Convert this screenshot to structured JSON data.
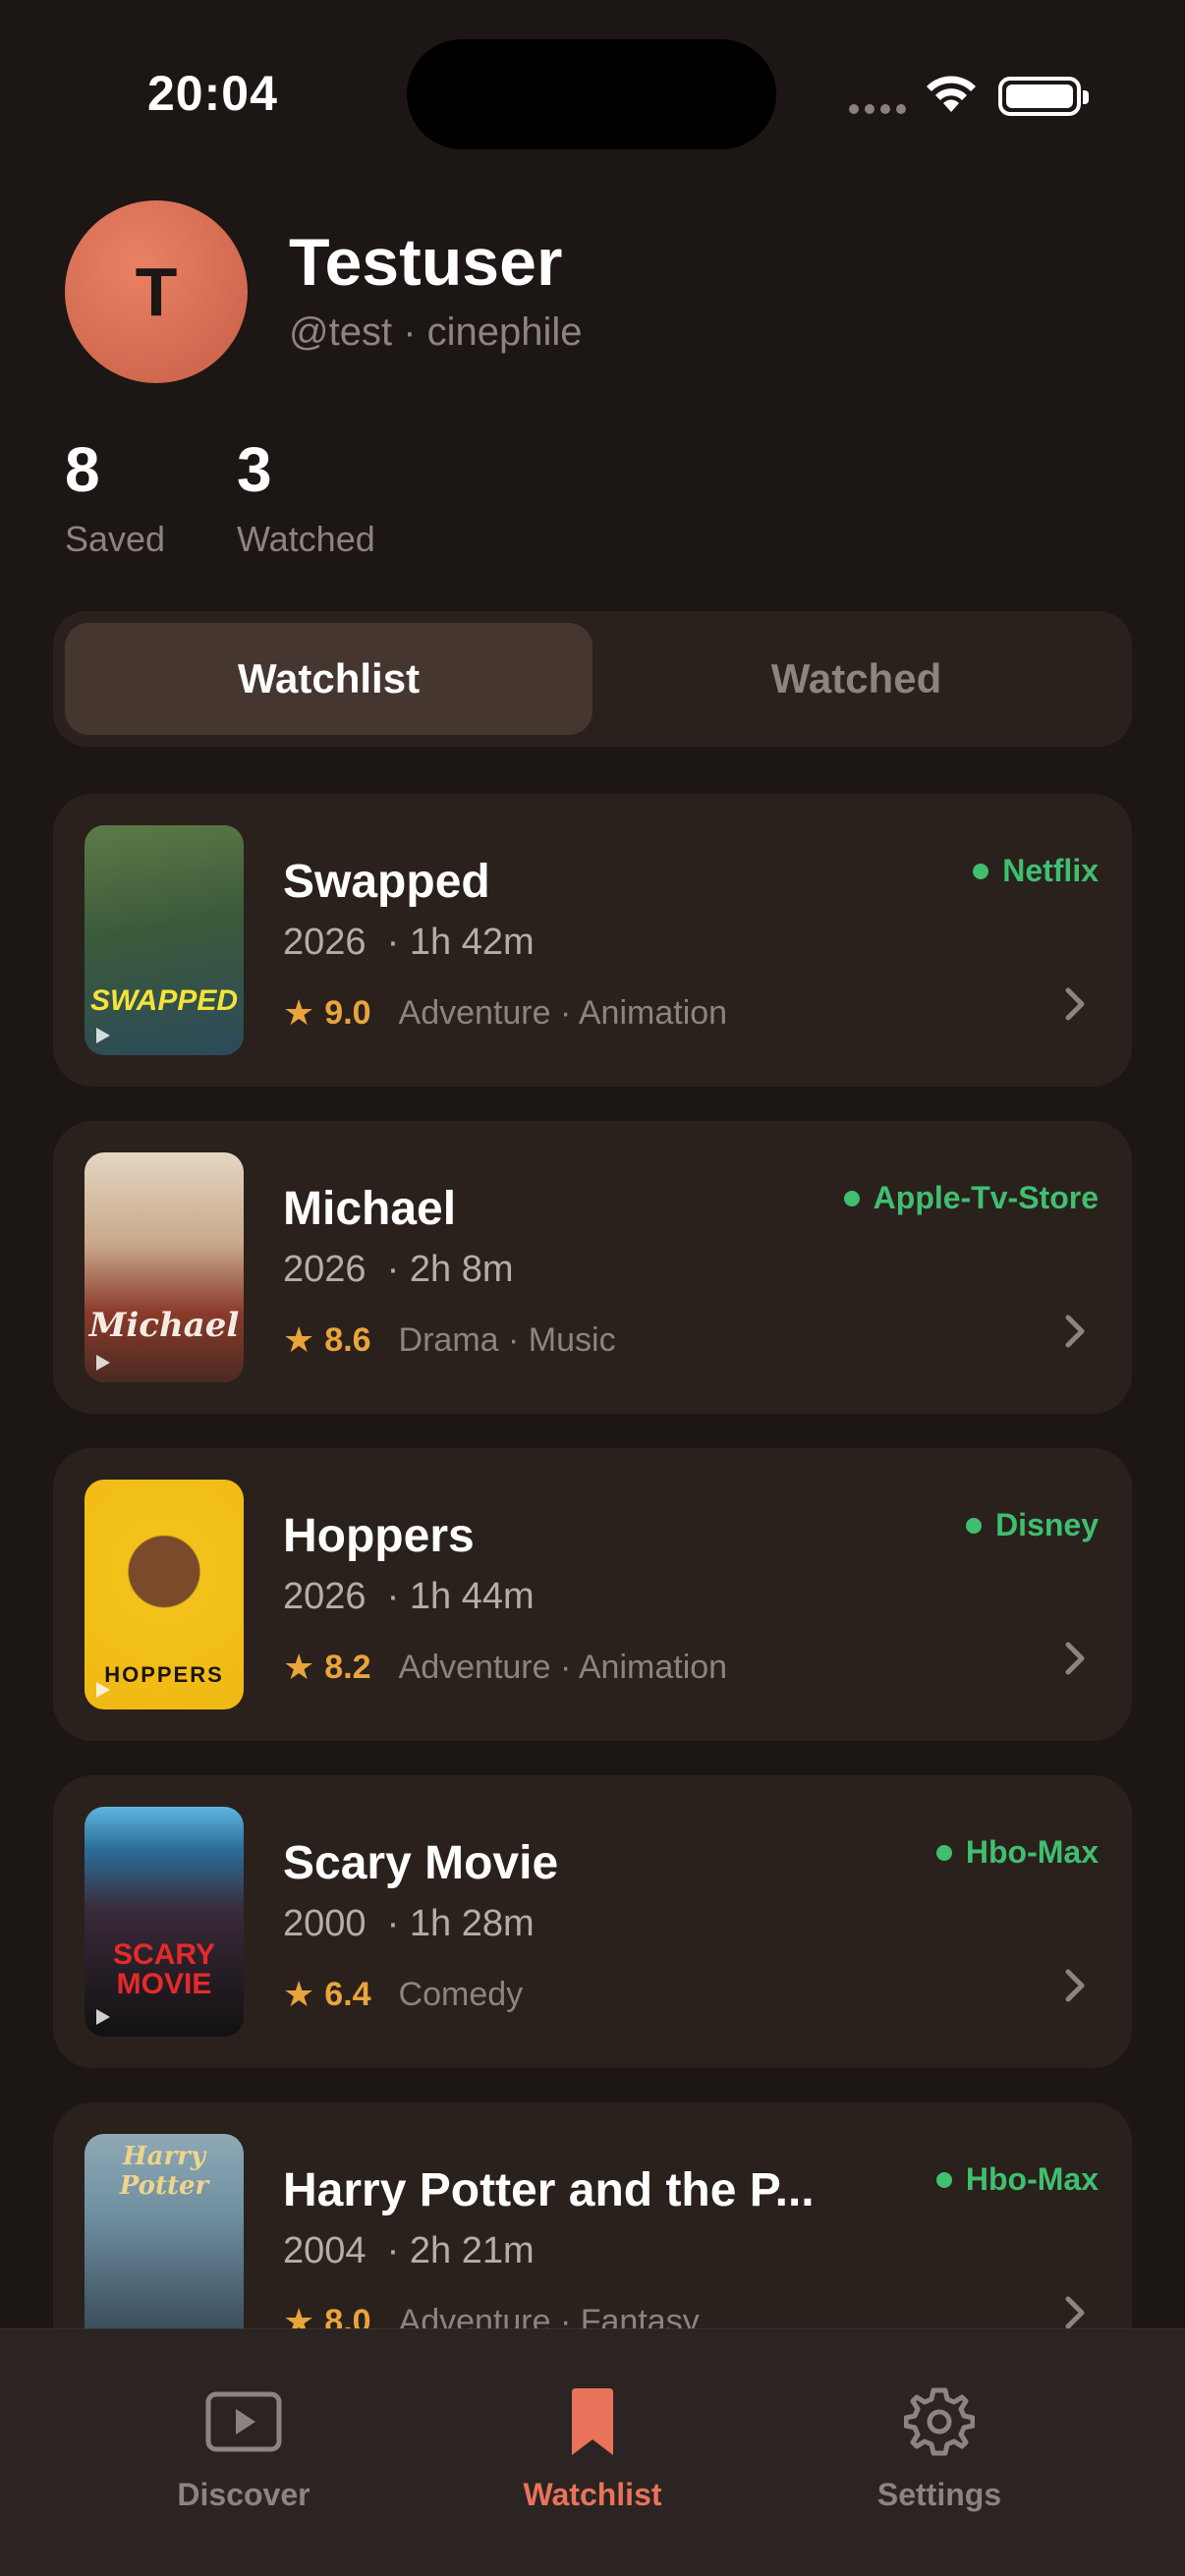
{
  "status_bar": {
    "time": "20:04"
  },
  "profile": {
    "avatar_initial": "T",
    "name": "Testuser",
    "handle": "@test · cinephile"
  },
  "stats": [
    {
      "value": "8",
      "label": "Saved"
    },
    {
      "value": "3",
      "label": "Watched"
    }
  ],
  "segmented": {
    "watchlist_label": "Watchlist",
    "watched_label": "Watched",
    "selected": "Watchlist"
  },
  "movies": [
    {
      "title": "Swapped",
      "year": "2026",
      "runtime": "· 1h 42m",
      "rating": "9.0",
      "genres": "Adventure · Animation",
      "provider": "Netflix",
      "poster_text": "SWAPPED",
      "poster_colors": [
        "#3b5a3a",
        "#2c4a5a"
      ]
    },
    {
      "title": "Michael",
      "year": "2026",
      "runtime": "· 2h 8m",
      "rating": "8.6",
      "genres": "Drama · Music",
      "provider": "Apple-Tv-Store",
      "poster_text": "Michael",
      "poster_colors": [
        "#d9c7b0",
        "#8a3a2a"
      ]
    },
    {
      "title": "Hoppers",
      "year": "2026",
      "runtime": "· 1h 44m",
      "rating": "8.2",
      "genres": "Adventure · Animation",
      "provider": "Disney",
      "poster_text": "HOPPERS",
      "poster_colors": [
        "#f3c21a",
        "#e0a510"
      ]
    },
    {
      "title": "Scary Movie",
      "year": "2000",
      "runtime": "· 1h 28m",
      "rating": "6.4",
      "genres": "Comedy",
      "provider": "Hbo-Max",
      "poster_text": "SCARY MOVIE",
      "poster_colors": [
        "#2a6f9a",
        "#111111"
      ]
    },
    {
      "title": "Harry Potter and the P...",
      "year": "2004",
      "runtime": "· 2h 21m",
      "rating": "8.0",
      "genres": "Adventure · Fantasy",
      "provider": "Hbo-Max",
      "poster_text": "Harry Potter",
      "poster_colors": [
        "#6e8fa0",
        "#2b3a46"
      ]
    }
  ],
  "tabbar": {
    "items": [
      {
        "label": "Discover",
        "icon": "play-rectangle-icon"
      },
      {
        "label": "Watchlist",
        "icon": "bookmark-icon"
      },
      {
        "label": "Settings",
        "icon": "gear-icon"
      }
    ],
    "active": "Watchlist"
  },
  "colors": {
    "accent": "#e8735a",
    "provider_green": "#3fbf6f",
    "rating_gold": "#e8a53b",
    "background": "#1c1614",
    "card": "#2a211d"
  }
}
